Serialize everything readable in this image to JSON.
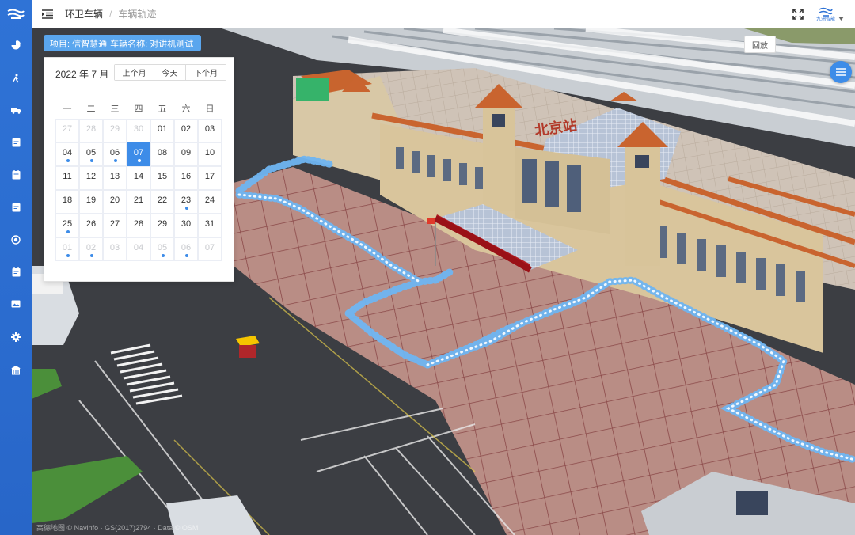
{
  "header": {
    "breadcrumb": [
      "环卫车辆",
      "车辆轨迹"
    ],
    "brand_label": "九洲智能"
  },
  "sidebar": {
    "items": [
      {
        "name": "dashboard",
        "icon": "pie-chart-icon"
      },
      {
        "name": "personnel",
        "icon": "walking-person-icon"
      },
      {
        "name": "vehicles",
        "icon": "truck-icon"
      },
      {
        "name": "reports-1",
        "icon": "document-icon"
      },
      {
        "name": "reports-2",
        "icon": "document-icon"
      },
      {
        "name": "reports-3",
        "icon": "document-icon"
      },
      {
        "name": "monitor",
        "icon": "target-icon"
      },
      {
        "name": "reports-4",
        "icon": "document-icon"
      },
      {
        "name": "images",
        "icon": "image-icon"
      },
      {
        "name": "settings",
        "icon": "gear-icon"
      },
      {
        "name": "facilities",
        "icon": "building-icon"
      }
    ]
  },
  "info_tag": {
    "project": "项目: 信智慧通",
    "vehicle": "车辆名称: 对讲机测试"
  },
  "controls": {
    "back_label": "回放",
    "menu_icon": "list-icon"
  },
  "calendar": {
    "title": "2022 年 7 月",
    "buttons": {
      "prev": "上个月",
      "today": "今天",
      "next": "下个月"
    },
    "weekdays": [
      "一",
      "二",
      "三",
      "四",
      "五",
      "六",
      "日"
    ],
    "selected_day": "07",
    "weeks": [
      [
        {
          "d": "27",
          "other": true
        },
        {
          "d": "28",
          "other": true
        },
        {
          "d": "29",
          "other": true
        },
        {
          "d": "30",
          "other": true
        },
        {
          "d": "01"
        },
        {
          "d": "02"
        },
        {
          "d": "03"
        }
      ],
      [
        {
          "d": "04",
          "dot": true
        },
        {
          "d": "05",
          "dot": true
        },
        {
          "d": "06",
          "dot": true
        },
        {
          "d": "07",
          "dot": true,
          "sel": true
        },
        {
          "d": "08"
        },
        {
          "d": "09"
        },
        {
          "d": "10"
        }
      ],
      [
        {
          "d": "11"
        },
        {
          "d": "12"
        },
        {
          "d": "13"
        },
        {
          "d": "14"
        },
        {
          "d": "15"
        },
        {
          "d": "16"
        },
        {
          "d": "17"
        }
      ],
      [
        {
          "d": "18"
        },
        {
          "d": "19"
        },
        {
          "d": "20"
        },
        {
          "d": "21"
        },
        {
          "d": "22"
        },
        {
          "d": "23",
          "dot": true
        },
        {
          "d": "24"
        }
      ],
      [
        {
          "d": "25",
          "dot": true
        },
        {
          "d": "26"
        },
        {
          "d": "27"
        },
        {
          "d": "28"
        },
        {
          "d": "29"
        },
        {
          "d": "30"
        },
        {
          "d": "31"
        }
      ],
      [
        {
          "d": "01",
          "other": true,
          "dot": true
        },
        {
          "d": "02",
          "other": true,
          "dot": true
        },
        {
          "d": "03",
          "other": true
        },
        {
          "d": "04",
          "other": true
        },
        {
          "d": "05",
          "other": true,
          "dot": true
        },
        {
          "d": "06",
          "other": true,
          "dot": true
        },
        {
          "d": "07",
          "other": true
        }
      ]
    ]
  },
  "map": {
    "station_sign": "北京站",
    "copyright": "高德地图 © Navinfo · GS(2017)2794 · Data © OSM"
  },
  "colors": {
    "primary": "#3d8ce8",
    "sidebar": "#2f73d6",
    "track": "#6fb6f2",
    "plaza": "#b78c84",
    "roof": "#c9642f"
  }
}
